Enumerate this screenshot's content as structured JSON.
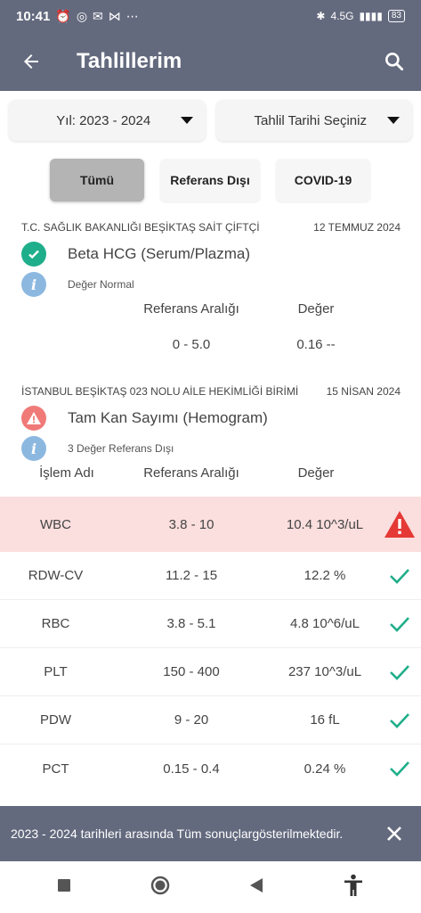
{
  "status_bar": {
    "time": "10:41",
    "network": "4.5G",
    "battery": "83"
  },
  "app_bar": {
    "title": "Tahlillerim",
    "back_icon": "arrow-left-icon",
    "search_icon": "search-icon"
  },
  "filters": {
    "year": "Yıl: 2023 - 2024",
    "date": "Tahlil Tarihi Seçiniz"
  },
  "tabs": [
    {
      "label": "Tümü",
      "active": true
    },
    {
      "label": "Referans Dışı",
      "active": false
    },
    {
      "label": "COVID-19",
      "active": false
    }
  ],
  "results": [
    {
      "institution": "T.C. SAĞLIK BAKANLIĞI BEŞİKTAŞ SAİT ÇİFTÇİ",
      "date": "12 TEMMUZ 2024",
      "test_name": "Beta HCG (Serum/Plazma)",
      "status_text": "Değer Normal",
      "ref_header": "Referans Aralığı",
      "val_header": "Değer",
      "ref_value": "0 - 5.0",
      "value": "0.16 --"
    },
    {
      "institution": "İSTANBUL BEŞİKTAŞ 023 NOLU AİLE HEKİMLİĞİ BİRİMİ",
      "date": "15 NİSAN 2024",
      "test_name": "Tam Kan Sayımı (Hemogram)",
      "status_text": "3 Değer Referans Dışı",
      "columns": {
        "name": "İşlem Adı",
        "ref": "Referans Aralığı",
        "value": "Değer"
      },
      "rows": [
        {
          "name": "WBC",
          "ref": "3.8 - 10",
          "value": "10.4 10^3/uL",
          "status": "alert"
        },
        {
          "name": "RDW-CV",
          "ref": "11.2 - 15",
          "value": "12.2 %",
          "status": "ok"
        },
        {
          "name": "RBC",
          "ref": "3.8 - 5.1",
          "value": "4.8 10^6/uL",
          "status": "ok"
        },
        {
          "name": "PLT",
          "ref": "150 - 400",
          "value": "237 10^3/uL",
          "status": "ok"
        },
        {
          "name": "PDW",
          "ref": "9 - 20",
          "value": "16 fL",
          "status": "ok"
        },
        {
          "name": "PCT",
          "ref": "0.15 - 0.4",
          "value": "0.24 %",
          "status": "ok"
        }
      ]
    }
  ],
  "toast": {
    "message": "2023 - 2024 tarihleri arasında Tüm sonuçlargösterilmektedir."
  },
  "colors": {
    "header": "#646a7e",
    "ok": "#1fae8b",
    "warn": "#e53935",
    "alert_row": "#fbdede",
    "info": "#8cb8e0"
  }
}
